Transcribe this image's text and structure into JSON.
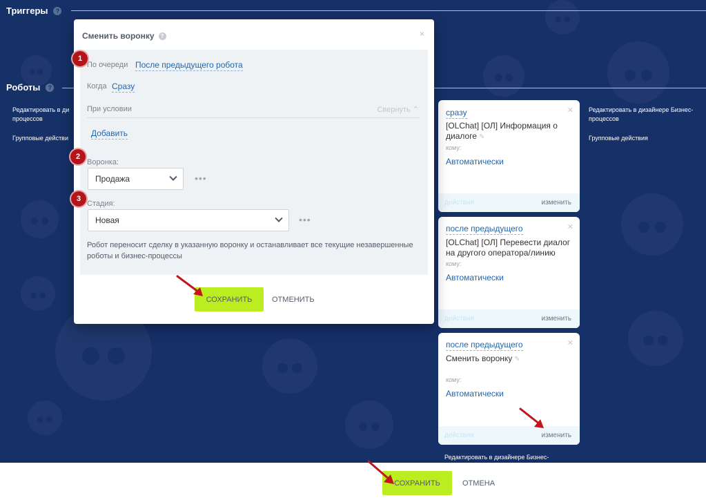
{
  "sections": {
    "triggers": "Триггеры",
    "robots": "Роботы"
  },
  "side_links": {
    "edit_designer_left": "Редактировать в ди",
    "edit_designer_left_2": "процессов",
    "group_actions_left": "Групповые действи",
    "edit_designer_right": "Редактировать в дизайнере Бизнес-",
    "edit_designer_right_2": "процессов",
    "group_actions_right": "Групповые действия",
    "edit_designer_bottom": "Редактировать в дизайнере Бизнес-"
  },
  "cards": [
    {
      "when": "сразу",
      "name": "[OLChat] [ОЛ] Информация о диалоге",
      "to_label": "кому:",
      "to_value": "Автоматически",
      "actions": "действия",
      "change": "изменить"
    },
    {
      "when": "после предыдущего",
      "name": "[OLChat] [ОЛ] Перевести диалог на другого оператора/линию",
      "to_label": "кому:",
      "to_value": "Автоматически",
      "actions": "действия",
      "change": "изменить"
    },
    {
      "when": "после предыдущего",
      "name": "Сменить воронку",
      "to_label": "кому:",
      "to_value": "Автоматически",
      "actions": "действия",
      "change": "изменить"
    }
  ],
  "modal": {
    "title": "Сменить воронку",
    "close": "×",
    "order_label": "По очереди",
    "order_value": "После предыдущего робота",
    "when_label": "Когда",
    "when_value": "Сразу",
    "condition_label": "При условии",
    "collapse_label": "Свернуть",
    "add_label": "Добавить",
    "funnel_label": "Воронка:",
    "funnel_value": "Продажа",
    "stage_label": "Стадия:",
    "stage_value": "Новая",
    "description": "Робот переносит сделку в указанную воронку и останавливает все текущие незавершенные роботы и бизнес-процессы",
    "save": "СОХРАНИТЬ",
    "cancel": "ОТМЕНИТЬ"
  },
  "badges": [
    "1",
    "2",
    "3"
  ],
  "bottom": {
    "save": "СОХРАНИТЬ",
    "cancel": "ОТМЕНА"
  },
  "colors": {
    "background": "#163068",
    "accent_green": "#bbed21",
    "link_blue": "#2067b0",
    "badge_red": "#b3151a",
    "arrow_red": "#c0161c"
  }
}
